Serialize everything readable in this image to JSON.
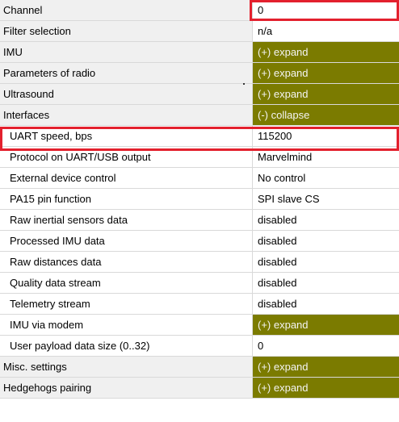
{
  "rows": [
    {
      "name": "Channel",
      "value": "0",
      "indent": false,
      "kind": "value"
    },
    {
      "name": "Filter selection",
      "value": "n/a",
      "indent": false,
      "kind": "value"
    },
    {
      "name": "IMU",
      "value": "(+) expand",
      "indent": false,
      "kind": "action"
    },
    {
      "name": "Parameters of radio",
      "value": "(+) expand",
      "indent": false,
      "kind": "action"
    },
    {
      "name": "Ultrasound",
      "value": "(+) expand",
      "indent": false,
      "kind": "action"
    },
    {
      "name": "Interfaces",
      "value": "(-) collapse",
      "indent": false,
      "kind": "collapse"
    },
    {
      "name": "UART speed, bps",
      "value": "115200",
      "indent": true,
      "kind": "value"
    },
    {
      "name": "Protocol on UART/USB output",
      "value": "Marvelmind",
      "indent": true,
      "kind": "value"
    },
    {
      "name": "External device control",
      "value": "No control",
      "indent": true,
      "kind": "value"
    },
    {
      "name": "PA15 pin function",
      "value": "SPI slave CS",
      "indent": true,
      "kind": "value"
    },
    {
      "name": "Raw inertial sensors data",
      "value": "disabled",
      "indent": true,
      "kind": "value"
    },
    {
      "name": "Processed IMU data",
      "value": "disabled",
      "indent": true,
      "kind": "value"
    },
    {
      "name": "Raw distances data",
      "value": "disabled",
      "indent": true,
      "kind": "value"
    },
    {
      "name": "Quality data stream",
      "value": "disabled",
      "indent": true,
      "kind": "value"
    },
    {
      "name": "Telemetry stream",
      "value": "disabled",
      "indent": true,
      "kind": "value"
    },
    {
      "name": "IMU via modem",
      "value": "(+) expand",
      "indent": true,
      "kind": "action"
    },
    {
      "name": "User payload data size (0..32)",
      "value": "0",
      "indent": true,
      "kind": "value"
    },
    {
      "name": "Misc. settings",
      "value": "(+) expand",
      "indent": false,
      "kind": "action"
    },
    {
      "name": "Hedgehogs pairing",
      "value": "(+) expand",
      "indent": false,
      "kind": "action"
    }
  ],
  "colors": {
    "action_bg": "#7b7b00",
    "highlight": "#e3202d",
    "group_bg": "#f0f0f0"
  },
  "highlighted_row": "UART speed, bps"
}
